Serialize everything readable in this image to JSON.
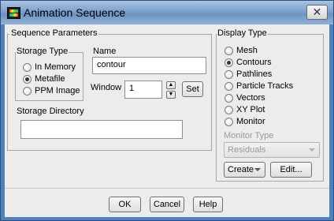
{
  "window": {
    "title": "Animation Sequence",
    "close_glyph": "✕"
  },
  "sequence_parameters": {
    "title": "Sequence Parameters",
    "storage_type": {
      "title": "Storage Type",
      "options": [
        "In Memory",
        "Metafile",
        "PPM Image"
      ],
      "selected": "Metafile"
    },
    "name": {
      "label": "Name",
      "value": "contour"
    },
    "window": {
      "label": "Window",
      "value": "1",
      "up_glyph": "▲",
      "down_glyph": "▼",
      "set_label": "Set"
    },
    "storage_directory": {
      "label": "Storage Directory",
      "value": ""
    }
  },
  "display_type": {
    "title": "Display Type",
    "options": [
      "Mesh",
      "Contours",
      "Pathlines",
      "Particle Tracks",
      "Vectors",
      "XY Plot",
      "Monitor"
    ],
    "selected": "Contours",
    "monitor_type": {
      "label": "Monitor Type",
      "value": "Residuals"
    },
    "create_label": "Create",
    "edit_label": "Edit..."
  },
  "buttons": {
    "ok": "OK",
    "cancel": "Cancel",
    "help": "Help"
  }
}
